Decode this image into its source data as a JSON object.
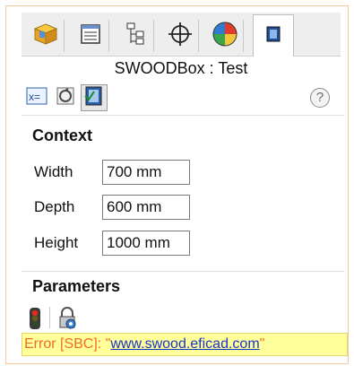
{
  "header": {
    "title": "SWOODBox : Test"
  },
  "tabs": [
    {
      "icon": "part-cube-icon"
    },
    {
      "icon": "property-list-icon"
    },
    {
      "icon": "tree-structure-icon"
    },
    {
      "icon": "crosshair-icon"
    },
    {
      "icon": "appearance-sphere-icon"
    },
    {
      "icon": "swood-panel-icon",
      "active": true
    }
  ],
  "toolbar": {
    "buttons": [
      {
        "icon": "equation-icon"
      },
      {
        "icon": "rebuild-icon"
      },
      {
        "icon": "swoodbox-icon",
        "pressed": true
      }
    ],
    "help_label": "?"
  },
  "context": {
    "title": "Context",
    "fields": [
      {
        "label": "Width",
        "value": "700 mm"
      },
      {
        "label": "Depth",
        "value": "600 mm"
      },
      {
        "label": "Height",
        "value": "1000 mm"
      }
    ]
  },
  "parameters": {
    "title": "Parameters",
    "icons": [
      "traffic-light-icon",
      "lock-view-icon"
    ]
  },
  "status": {
    "prefix": "Error [SBC]: \"",
    "link": "www.swood.eficad.com",
    "suffix": "\""
  },
  "colors": {
    "frame_border": "#f3c99a",
    "status_bg": "#ffff9c",
    "error_text": "#ee6d24",
    "link": "#1a33c9"
  }
}
